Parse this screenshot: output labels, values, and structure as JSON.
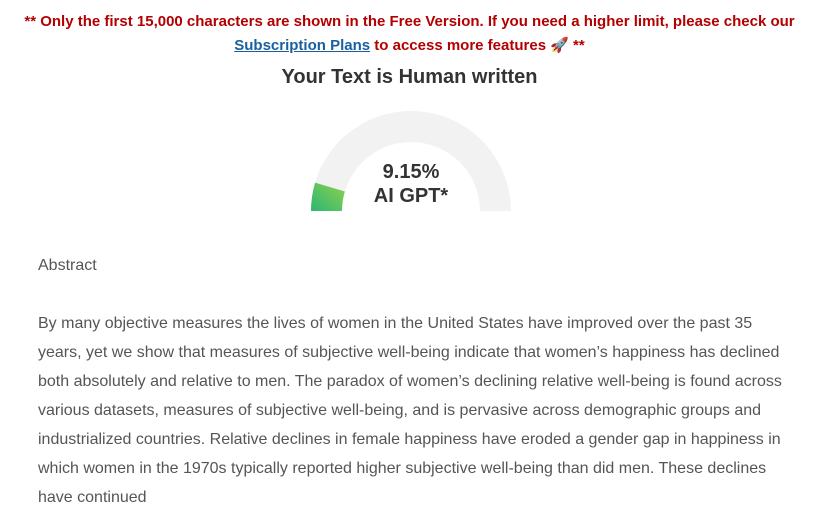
{
  "notice": {
    "prefix": "** Only the first 15,000 characters are shown in the Free Version. If you need a higher limit, please check our",
    "link_label": "Subscription Plans",
    "suffix": "to access more features 🚀 **"
  },
  "result": {
    "title": "Your Text is Human written",
    "percent_label": "9.15%",
    "percent_value": 9.15,
    "model_label": "AI GPT*"
  },
  "gauge_colors": {
    "track": "#f2f2f2",
    "fill_start": "#2bb673",
    "fill_end": "#8fd14f"
  },
  "document": {
    "heading": "Abstract",
    "body": "By many objective measures the lives of women in the United States have improved over the past 35 years, yet we show that measures of subjective well-being indicate that women’s happiness has declined both absolutely and relative to men. The paradox of women’s declining relative well-being is found across various datasets, measures of subjective well-being, and is pervasive across demographic groups and industrialized countries. Relative declines in female happiness have eroded a gender gap in happiness in which women in the 1970s typically reported higher subjective well-being than did men. These declines have continued"
  }
}
